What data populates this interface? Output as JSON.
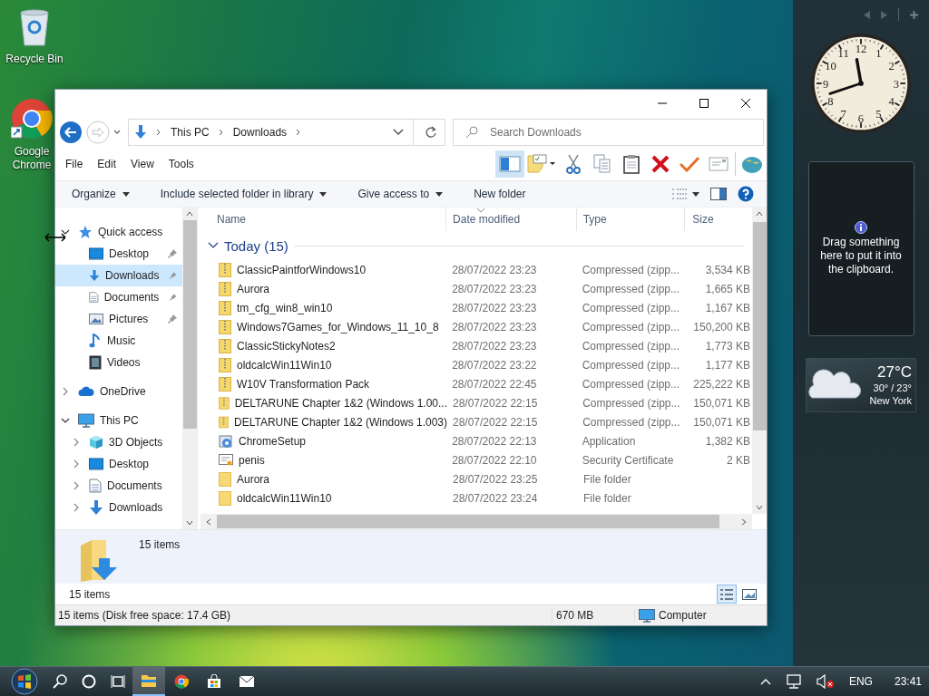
{
  "desktop_icons": [
    {
      "label": "Recycle Bin",
      "kind": "recycle"
    },
    {
      "label": "Google Chrome",
      "kind": "chrome"
    }
  ],
  "explorer": {
    "address": {
      "crumbs": [
        "This PC",
        "Downloads"
      ]
    },
    "search": {
      "placeholder": "Search Downloads"
    },
    "menu": [
      "File",
      "Edit",
      "View",
      "Tools"
    ],
    "pane_toggle": {
      "on": true
    },
    "toolbar_icons": [
      {
        "kind": "notes"
      },
      {
        "kind": "scissors"
      },
      {
        "kind": "copy"
      },
      {
        "kind": "clipboard"
      },
      {
        "kind": "delete"
      },
      {
        "kind": "check"
      },
      {
        "kind": "envelope"
      },
      {
        "kind": "globe"
      }
    ],
    "commands": [
      {
        "label": "Organize",
        "dropdown": true
      },
      {
        "label": "Include selected folder in library",
        "dropdown": true
      },
      {
        "label": "Give access to",
        "dropdown": true
      },
      {
        "label": "New folder",
        "dropdown": false
      }
    ],
    "nav": [
      {
        "label": "Quick access",
        "kind": "star",
        "expanded": true,
        "children": [
          {
            "label": "Desktop",
            "kind": "desktop",
            "pinned": true,
            "selected": false
          },
          {
            "label": "Downloads",
            "kind": "download",
            "pinned": true,
            "selected": true
          },
          {
            "label": "Documents",
            "kind": "document",
            "pinned": true,
            "selected": false
          },
          {
            "label": "Pictures",
            "kind": "pictures",
            "pinned": true,
            "selected": false
          },
          {
            "label": "Music",
            "kind": "music",
            "pinned": false,
            "selected": false
          },
          {
            "label": "Videos",
            "kind": "video",
            "pinned": false,
            "selected": false
          }
        ]
      },
      {
        "label": "OneDrive",
        "kind": "cloud",
        "expanded": false
      },
      {
        "label": "This PC",
        "kind": "pc",
        "expanded": true,
        "children": [
          {
            "label": "3D Objects",
            "kind": "objects",
            "expanded": false,
            "selected": false
          },
          {
            "label": "Desktop",
            "kind": "desktop",
            "expanded": false,
            "selected": false
          },
          {
            "label": "Documents",
            "kind": "document",
            "expanded": false,
            "selected": false
          },
          {
            "label": "Downloads",
            "kind": "download",
            "expanded": false,
            "selected": false
          }
        ]
      }
    ],
    "columns": [
      {
        "label": "Name",
        "sorted": false
      },
      {
        "label": "Date modified",
        "sorted": true
      },
      {
        "label": "Type",
        "sorted": false
      },
      {
        "label": "Size",
        "sorted": false
      }
    ],
    "group": {
      "label": "Today (15)",
      "expanded": true
    },
    "files": [
      {
        "name": "ClassicPaintforWindows10",
        "date": "28/07/2022 23:23",
        "type": "Compressed (zipp...",
        "size": "3,534 KB",
        "kind": "zip"
      },
      {
        "name": "Aurora",
        "date": "28/07/2022 23:23",
        "type": "Compressed (zipp...",
        "size": "1,665 KB",
        "kind": "zip"
      },
      {
        "name": "tm_cfg_win8_win10",
        "date": "28/07/2022 23:23",
        "type": "Compressed (zipp...",
        "size": "1,167 KB",
        "kind": "zip"
      },
      {
        "name": "Windows7Games_for_Windows_11_10_8",
        "date": "28/07/2022 23:23",
        "type": "Compressed (zipp...",
        "size": "150,200 KB",
        "kind": "zip"
      },
      {
        "name": "ClassicStickyNotes2",
        "date": "28/07/2022 23:23",
        "type": "Compressed (zipp...",
        "size": "1,773 KB",
        "kind": "zip"
      },
      {
        "name": "oldcalcWin11Win10",
        "date": "28/07/2022 23:22",
        "type": "Compressed (zipp...",
        "size": "1,177 KB",
        "kind": "zip"
      },
      {
        "name": "W10V Transformation Pack",
        "date": "28/07/2022 22:45",
        "type": "Compressed (zipp...",
        "size": "225,222 KB",
        "kind": "zip"
      },
      {
        "name": "DELTARUNE Chapter 1&2 (Windows 1.00...",
        "date": "28/07/2022 22:15",
        "type": "Compressed (zipp...",
        "size": "150,071 KB",
        "kind": "zip"
      },
      {
        "name": "DELTARUNE Chapter 1&2 (Windows 1.003)",
        "date": "28/07/2022 22:15",
        "type": "Compressed (zipp...",
        "size": "150,071 KB",
        "kind": "zip"
      },
      {
        "name": "ChromeSetup",
        "date": "28/07/2022 22:13",
        "type": "Application",
        "size": "1,382 KB",
        "kind": "app"
      },
      {
        "name": "penis",
        "date": "28/07/2022 22:10",
        "type": "Security Certificate",
        "size": "2 KB",
        "kind": "cert"
      },
      {
        "name": "Aurora",
        "date": "28/07/2022 23:25",
        "type": "File folder",
        "kind": "folder"
      },
      {
        "name": "oldcalcWin11Win10",
        "date": "28/07/2022 23:24",
        "type": "File folder",
        "kind": "folder"
      }
    ],
    "details": {
      "summary": "15 items"
    },
    "item_count": "15 items",
    "views": [
      {
        "kind": "details",
        "selected": true
      },
      {
        "kind": "preview",
        "selected": false
      }
    ],
    "status_bar": {
      "summary": "15 items (Disk free space: 17.4 GB)",
      "size": "670 MB",
      "location": "Computer"
    }
  },
  "gadgets": {
    "clock": {
      "numerals": [
        "12",
        "1",
        "2",
        "3",
        "4",
        "5",
        "6",
        "7",
        "8",
        "9",
        "10",
        "11"
      ]
    },
    "clipboard": {
      "message": "Drag something here to put it into the clipboard."
    },
    "weather": {
      "temperature": "27°C",
      "range": "30° / 23°",
      "city": "New York"
    }
  },
  "taskbar": {
    "apps": [
      {
        "kind": "explorer",
        "selected": true
      },
      {
        "kind": "chrome",
        "selected": false
      },
      {
        "kind": "store",
        "selected": false
      },
      {
        "kind": "mail",
        "selected": false
      }
    ],
    "volume_muted": true,
    "language": "ENG",
    "time": "23:41"
  }
}
